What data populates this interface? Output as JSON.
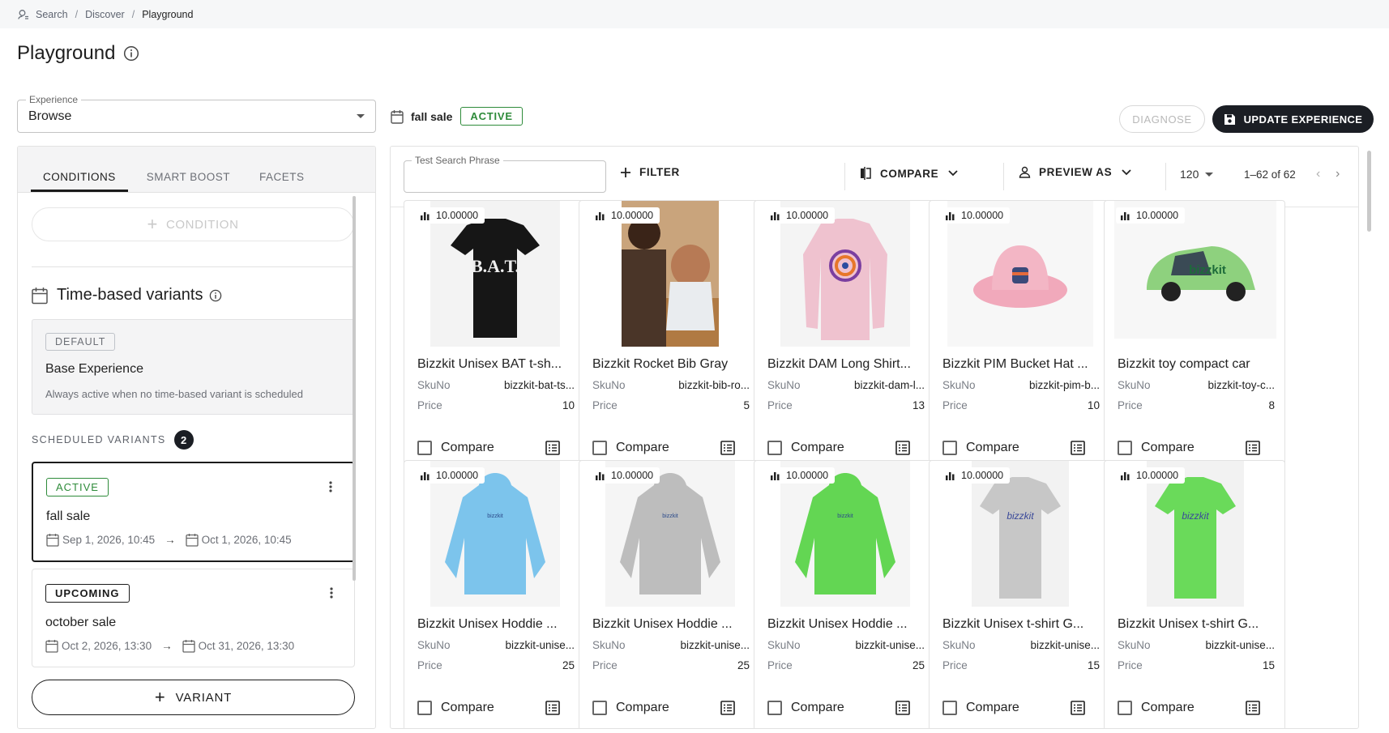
{
  "breadcrumb": [
    "Search",
    "Discover",
    "Playground"
  ],
  "page": {
    "title": "Playground"
  },
  "experience": {
    "label": "Experience",
    "value": "Browse"
  },
  "current_variant": {
    "name": "fall sale",
    "status": "ACTIVE"
  },
  "actions": {
    "diagnose": "DIAGNOSE",
    "update": "UPDATE EXPERIENCE"
  },
  "left": {
    "tabs": [
      "CONDITIONS",
      "SMART BOOST",
      "FACETS"
    ],
    "add_condition": "CONDITION",
    "section_title": "Time-based variants",
    "default": {
      "tag": "DEFAULT",
      "title": "Base Experience",
      "desc": "Always active when no time-based variant is scheduled"
    },
    "scheduled_label": "SCHEDULED VARIANTS",
    "scheduled_count": "2",
    "variants": [
      {
        "status": "ACTIVE",
        "name": "fall sale",
        "start": "Sep 1, 2026, 10:45",
        "end": "Oct 1, 2026, 10:45"
      },
      {
        "status": "UPCOMING",
        "name": "october sale",
        "start": "Oct 2, 2026, 13:30",
        "end": "Oct 31, 2026, 13:30"
      }
    ],
    "add_variant": "VARIANT"
  },
  "toolbar": {
    "search_label": "Test Search Phrase",
    "search_value": "",
    "filter": "FILTER",
    "compare": "COMPARE",
    "preview_as": "PREVIEW AS",
    "per_page": "120",
    "page_info": "1–62 of 62"
  },
  "colors": {
    "accent_dark": "#1b1e24",
    "active_green": "#2e8b3a"
  },
  "products": [
    {
      "name": "Bizzkit Unisex BAT t-sh...",
      "sku": "bizzkit-bat-ts...",
      "price": "10",
      "score": "10.00000",
      "image": "black-tshirt"
    },
    {
      "name": "Bizzkit Rocket Bib Gray",
      "sku": "bizzkit-bib-ro...",
      "price": "5",
      "score": "10.00000",
      "image": "baby-bib-photo"
    },
    {
      "name": "Bizzkit DAM Long Shirt...",
      "sku": "bizzkit-dam-l...",
      "price": "13",
      "score": "10.00000",
      "image": "pink-longsleeve"
    },
    {
      "name": "Bizzkit PIM Bucket Hat ...",
      "sku": "bizzkit-pim-b...",
      "price": "10",
      "score": "10.00000",
      "image": "pink-bucket-hat"
    },
    {
      "name": "Bizzkit toy compact car",
      "sku": "bizzkit-toy-c...",
      "price": "8",
      "score": "10.00000",
      "image": "green-car"
    },
    {
      "name": "Bizzkit Unisex Hoddie ...",
      "sku": "bizzkit-unise...",
      "price": "25",
      "score": "10.00000",
      "image": "blue-hoodie"
    },
    {
      "name": "Bizzkit Unisex Hoddie ...",
      "sku": "bizzkit-unise...",
      "price": "25",
      "score": "10.00000",
      "image": "grey-hoodie"
    },
    {
      "name": "Bizzkit Unisex Hoddie ...",
      "sku": "bizzkit-unise...",
      "price": "25",
      "score": "10.00000",
      "image": "green-hoodie"
    },
    {
      "name": "Bizzkit Unisex t-shirt G...",
      "sku": "bizzkit-unise...",
      "price": "15",
      "score": "10.00000",
      "image": "grey-tshirt"
    },
    {
      "name": "Bizzkit Unisex t-shirt G...",
      "sku": "bizzkit-unise...",
      "price": "15",
      "score": "10.00000",
      "image": "green-tshirt"
    }
  ],
  "card_labels": {
    "sku": "SkuNo",
    "price": "Price",
    "compare": "Compare"
  }
}
